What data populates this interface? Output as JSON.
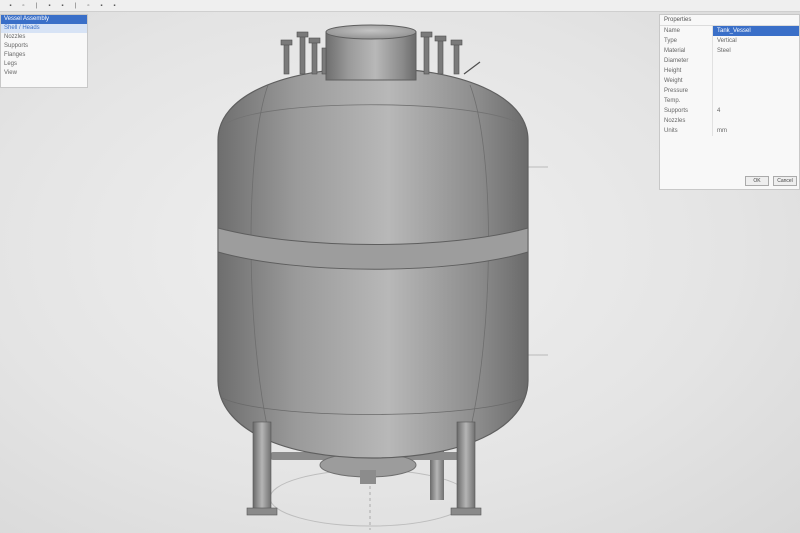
{
  "toolbar": {
    "buttons": [
      {
        "label": "▪",
        "icon": "square-icon"
      },
      {
        "label": "▫",
        "icon": "square-outline-icon"
      },
      {
        "label": "|",
        "icon": "separator-icon"
      },
      {
        "label": "▪",
        "icon": "square-icon"
      },
      {
        "label": "▪",
        "icon": "square-icon"
      },
      {
        "label": "|",
        "icon": "separator-icon"
      },
      {
        "label": "▫",
        "icon": "square-outline-icon"
      },
      {
        "label": "▪",
        "icon": "square-icon"
      },
      {
        "label": "▪",
        "icon": "square-icon"
      }
    ]
  },
  "model_tree": {
    "items": [
      {
        "label": "Vessel Assembly",
        "state": "sel"
      },
      {
        "label": "Shell / Heads",
        "state": "hl"
      },
      {
        "label": "Nozzles",
        "state": ""
      },
      {
        "label": "Supports",
        "state": ""
      },
      {
        "label": "Flanges",
        "state": ""
      },
      {
        "label": "Legs",
        "state": ""
      },
      {
        "label": "View",
        "state": ""
      }
    ]
  },
  "properties": {
    "title": "Properties",
    "rows": [
      {
        "key": "Name",
        "value": "Tank_Vessel",
        "selected": true
      },
      {
        "key": "Type",
        "value": "Vertical"
      },
      {
        "key": "Material",
        "value": "Steel"
      },
      {
        "key": "Diameter",
        "value": ""
      },
      {
        "key": "Height",
        "value": ""
      },
      {
        "key": "Weight",
        "value": ""
      },
      {
        "key": "Pressure",
        "value": ""
      },
      {
        "key": "Temp.",
        "value": ""
      },
      {
        "key": "Supports",
        "value": "4"
      },
      {
        "key": "Nozzles",
        "value": ""
      },
      {
        "key": "Units",
        "value": "mm"
      }
    ],
    "ok_label": "OK",
    "cancel_label": "Cancel"
  },
  "colors": {
    "selection": "#3a6fc8",
    "vessel_body": "#8f8f8f",
    "background": "#e6e6e6"
  }
}
